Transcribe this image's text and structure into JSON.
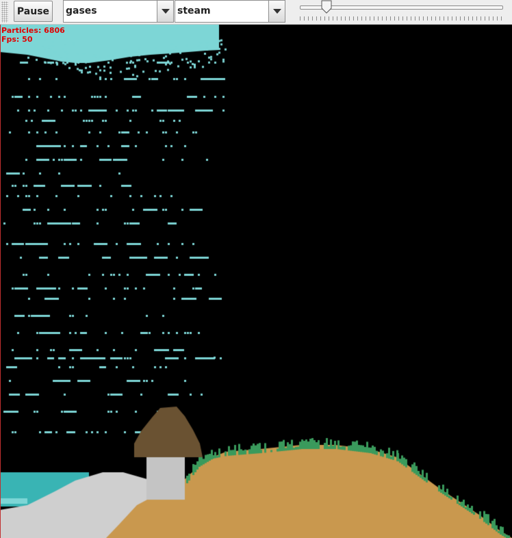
{
  "toolbar": {
    "pause_label": "Pause",
    "category": {
      "selected": "gases"
    },
    "element": {
      "selected": "steam"
    },
    "slider": {
      "value_fraction": 0.13
    }
  },
  "hud": {
    "particles_text": "Particles: 6806",
    "fps_text": "Fps: 50"
  },
  "colors": {
    "background": "#000000",
    "water": "#39b4b4",
    "steam": "#7dd6d6",
    "stone": "#cfcfcf",
    "sand": "#c9984e",
    "grass": "#3a9a5c",
    "mushroom_cap": "#6a5232",
    "mushroom_stem": "#c4c4c4",
    "hud_text": "#e00000"
  },
  "icons": {
    "grip": "toolbar-grip-icon",
    "combo_arrow": "chevron-down-icon",
    "slider_thumb": "slider-thumb-icon"
  }
}
